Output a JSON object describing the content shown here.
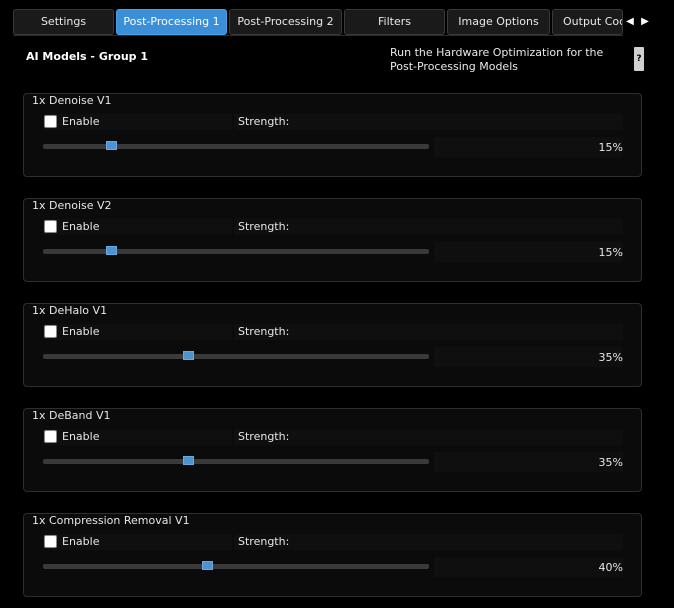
{
  "tabs": [
    {
      "label": "Settings",
      "active": false
    },
    {
      "label": "Post-Processing 1",
      "active": true
    },
    {
      "label": "Post-Processing 2",
      "active": false
    },
    {
      "label": "Filters",
      "active": false
    },
    {
      "label": "Image Options",
      "active": false
    },
    {
      "label": "Output Coc",
      "active": false
    }
  ],
  "nav": {
    "left_icon": "chevron-left-icon",
    "right_icon": "chevron-right-icon"
  },
  "group": {
    "title": "AI Models - Group 1",
    "hw_note": "Run the Hardware Optimization for the Post-Processing Models",
    "help_label": "?"
  },
  "labels": {
    "enable": "Enable",
    "strength": "Strength:"
  },
  "models": [
    {
      "name": "1x Denoise V1",
      "enabled": false,
      "strength_percent": 15,
      "value_text": "15%"
    },
    {
      "name": "1x Denoise V2",
      "enabled": false,
      "strength_percent": 15,
      "value_text": "15%"
    },
    {
      "name": "1x DeHalo V1",
      "enabled": false,
      "strength_percent": 35,
      "value_text": "35%"
    },
    {
      "name": "1x DeBand V1",
      "enabled": false,
      "strength_percent": 35,
      "value_text": "35%"
    },
    {
      "name": "1x Compression Removal V1",
      "enabled": false,
      "strength_percent": 40,
      "value_text": "40%"
    }
  ],
  "colors": {
    "accent": "#3a8fd6",
    "background": "#000000",
    "slider_handle": "#4f92d0"
  }
}
